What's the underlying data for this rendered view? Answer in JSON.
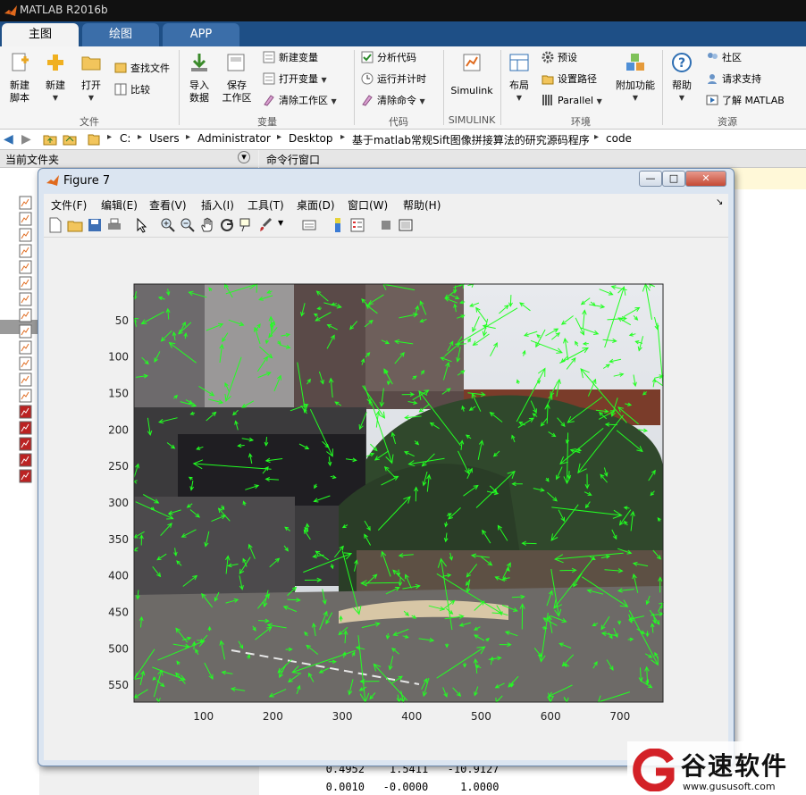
{
  "app": {
    "title": "MATLAB R2016b"
  },
  "tabs": [
    {
      "label": "主图"
    },
    {
      "label": "绘图"
    },
    {
      "label": "APP"
    }
  ],
  "ribbon": {
    "file": {
      "new_script": [
        "新建",
        "脚本"
      ],
      "new": "新建",
      "open": "打开",
      "find_files": "查找文件",
      "compare": "比较",
      "group": "文件"
    },
    "variable": {
      "import": [
        "导入",
        "数据"
      ],
      "save_ws": [
        "保存",
        "工作区"
      ],
      "new_var": "新建变量",
      "open_var": "打开变量",
      "clear_ws": "清除工作区",
      "group": "变量"
    },
    "code": {
      "analyze": "分析代码",
      "run_time": "运行并计时",
      "clear_cmd": "清除命令",
      "group": "代码"
    },
    "simulink": {
      "label": "Simulink",
      "group": "SIMULINK"
    },
    "env": {
      "layout": "布局",
      "prefs": "预设",
      "set_path": "设置路径",
      "parallel": "Parallel",
      "addons": "附加功能",
      "group": "环境"
    },
    "resources": {
      "help": "帮助",
      "community": "社区",
      "support": "请求支持",
      "learn": "了解 MATLAB",
      "group": "资源"
    }
  },
  "address": [
    "C:",
    "Users",
    "Administrator",
    "Desktop",
    "基于matlab常规Sift图像拼接算法的研究源码程序",
    "code"
  ],
  "panels": {
    "current_folder": "当前文件夹",
    "command_window": "命令行窗口",
    "matrix_rows": [
      [
        "0.4952",
        "1.5411",
        "-10.9127"
      ],
      [
        "0.0010",
        "-0.0000",
        "1.0000"
      ]
    ]
  },
  "figure": {
    "title": "Figure 7",
    "menu": [
      "文件(F)",
      "编辑(E)",
      "查看(V)",
      "插入(I)",
      "工具(T)",
      "桌面(D)",
      "窗口(W)",
      "帮助(H)"
    ],
    "window_buttons": {
      "minimize": "—",
      "maximize": "□",
      "close": "✕"
    },
    "y_ticks": [
      "50",
      "100",
      "150",
      "200",
      "250",
      "300",
      "350",
      "400",
      "450",
      "500",
      "550"
    ],
    "x_ticks": [
      "100",
      "200",
      "300",
      "400",
      "500",
      "600",
      "700"
    ],
    "overlay_color": "#22ff22"
  },
  "watermark": {
    "brand": "谷速软件",
    "url": "www.gususoft.com"
  }
}
